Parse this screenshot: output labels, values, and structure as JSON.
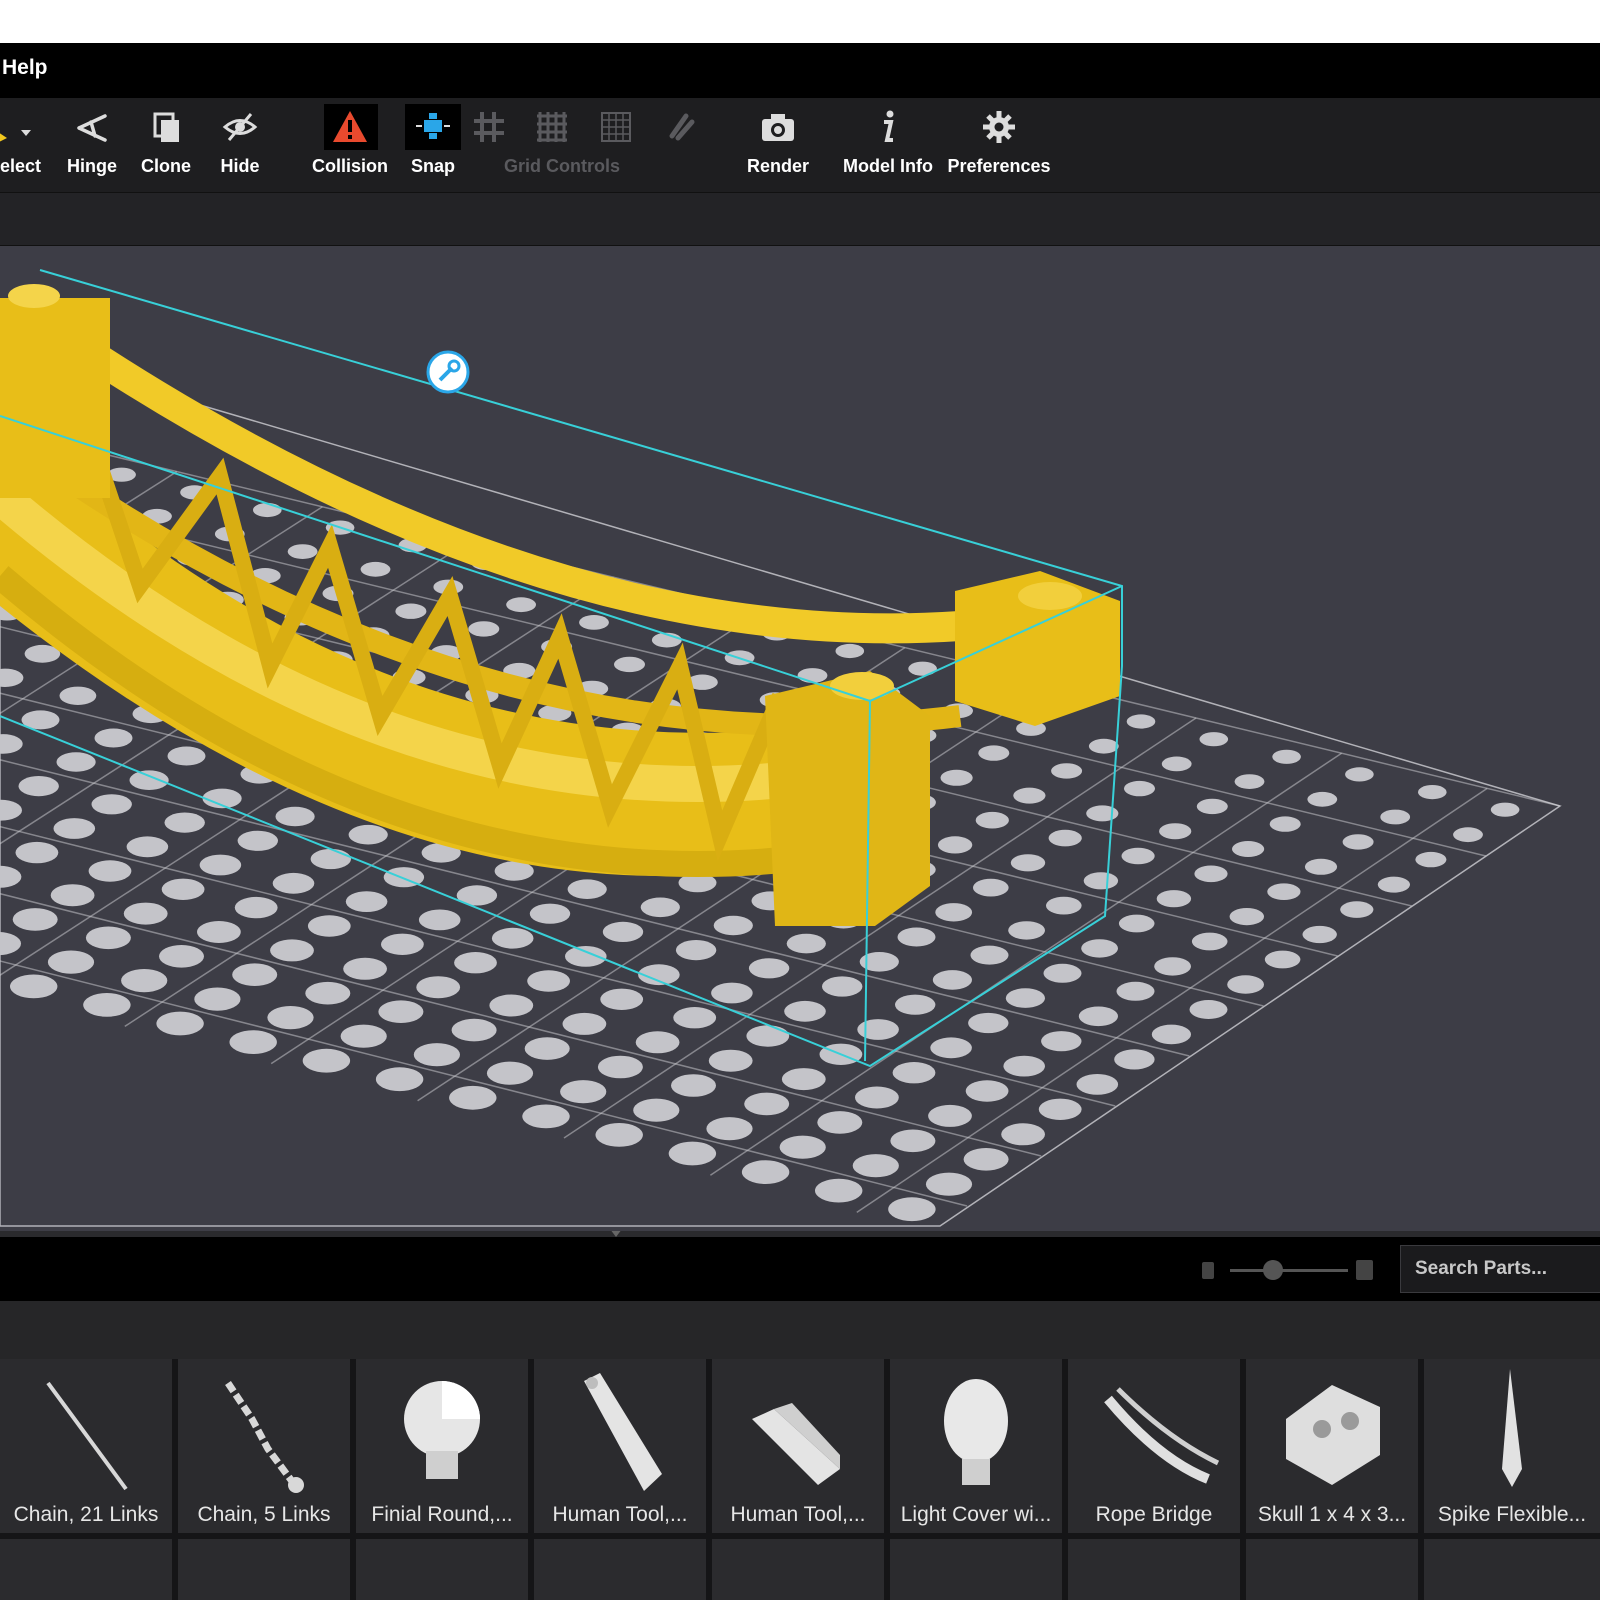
{
  "menu": {
    "help_label": "Help"
  },
  "toolbar": {
    "items": [
      {
        "label": "elect",
        "icon": "select-arrow-icon"
      },
      {
        "label": "Hinge",
        "icon": "hinge-icon"
      },
      {
        "label": "Clone",
        "icon": "clone-icon"
      },
      {
        "label": "Hide",
        "icon": "hide-eye-icon"
      },
      {
        "label": "Collision",
        "icon": "collision-warning-icon"
      },
      {
        "label": "Snap",
        "icon": "snap-icon"
      },
      {
        "label": "Grid Controls",
        "icon": "grid-icon",
        "disabled": true
      },
      {
        "label": "Render",
        "icon": "camera-icon"
      },
      {
        "label": "Model Info",
        "icon": "info-icon"
      },
      {
        "label": "Preferences",
        "icon": "gear-icon"
      }
    ]
  },
  "parts": {
    "search_placeholder": "Search Parts...",
    "tiles": [
      "Chain, 21 Links",
      "Chain, 5 Links",
      "Finial Round,...",
      "Human Tool,...",
      "Human Tool,...",
      "Light Cover wi...",
      "Rope Bridge",
      "Skull 1 x 4 x 3...",
      "Spike Flexible..."
    ]
  },
  "colors": {
    "brick_yellow": "#f2c81e",
    "selection_cyan": "#38d0d8",
    "viewport_bg": "#3d3d46",
    "collision_red": "#e84a2e",
    "snap_blue": "#2aa6e8"
  }
}
